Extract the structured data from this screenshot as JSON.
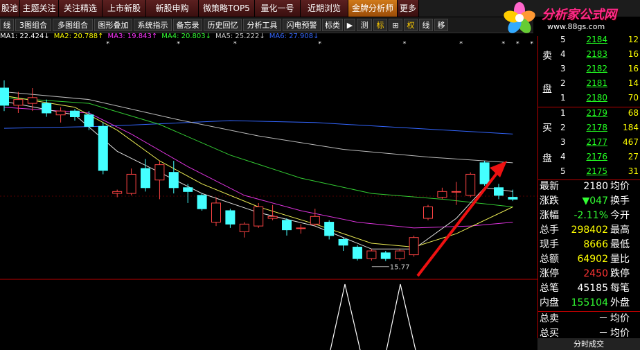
{
  "nav": {
    "tabs": [
      {
        "label": "股池"
      },
      {
        "label": "主题关注"
      },
      {
        "label": "关注精选"
      },
      {
        "label": "上市新股"
      },
      {
        "label": "新股申购"
      },
      {
        "label": "微策略TOP5"
      },
      {
        "label": "量化一号"
      },
      {
        "label": "近期浏览"
      },
      {
        "label": "金牌分析师"
      },
      {
        "label": "更多"
      }
    ],
    "active_index": 8
  },
  "toolbar": {
    "items": [
      {
        "label": "线"
      },
      {
        "label": "3图组合"
      },
      {
        "label": "多图组合"
      },
      {
        "label": "图形叠加"
      },
      {
        "label": "系统指示"
      },
      {
        "label": "备忘录"
      },
      {
        "label": "历史回忆"
      },
      {
        "label": "分析工具"
      },
      {
        "label": "闪电预警"
      },
      {
        "label": "标类"
      },
      {
        "label": "▶"
      },
      {
        "label": "测"
      },
      {
        "label": "标"
      },
      {
        "label": "⊞"
      },
      {
        "label": "权"
      },
      {
        "label": "线"
      },
      {
        "label": "移"
      }
    ]
  },
  "ma_legend": [
    {
      "label": "MA1: 22.424↓",
      "color": "#ffffff"
    },
    {
      "label": "MA2: 20.788↑",
      "color": "#ffff00"
    },
    {
      "label": "MA3: 19.843↑",
      "color": "#ff33ff"
    },
    {
      "label": "MA4: 20.803↓",
      "color": "#33ff33"
    },
    {
      "label": "MA5: 25.222↓",
      "color": "#cccccc"
    },
    {
      "label": "MA6: 27.908↓",
      "color": "#3366ff"
    }
  ],
  "chart_data": {
    "type": "candlestick",
    "low_marker": "15.77",
    "y_range": [
      15.0,
      26.5
    ],
    "candles": [
      {
        "o": 24.8,
        "c": 23.9,
        "h": 25.2,
        "l": 23.6
      },
      {
        "o": 23.9,
        "c": 24.2,
        "h": 24.6,
        "l": 23.5
      },
      {
        "o": 24.0,
        "c": 24.3,
        "h": 24.8,
        "l": 23.6
      },
      {
        "o": 24.0,
        "c": 23.5,
        "h": 24.2,
        "l": 23.3
      },
      {
        "o": 23.4,
        "c": 23.6,
        "h": 23.8,
        "l": 23.0
      },
      {
        "o": 23.6,
        "c": 23.3,
        "h": 23.7,
        "l": 23.1
      },
      {
        "o": 23.4,
        "c": 22.8,
        "h": 23.6,
        "l": 22.6
      },
      {
        "o": 22.8,
        "c": 20.5,
        "h": 23.0,
        "l": 20.3
      },
      {
        "o": 19.3,
        "c": 19.4,
        "h": 19.5,
        "l": 19.1
      },
      {
        "o": 19.3,
        "c": 20.3,
        "h": 20.6,
        "l": 19.2
      },
      {
        "o": 20.6,
        "c": 19.6,
        "h": 21.1,
        "l": 19.4
      },
      {
        "o": 20.0,
        "c": 20.8,
        "h": 21.0,
        "l": 19.0
      },
      {
        "o": 20.4,
        "c": 19.6,
        "h": 21.0,
        "l": 19.3
      },
      {
        "o": 19.6,
        "c": 19.4,
        "h": 19.8,
        "l": 18.8
      },
      {
        "o": 19.2,
        "c": 18.5,
        "h": 19.3,
        "l": 18.4
      },
      {
        "o": 17.8,
        "c": 18.8,
        "h": 19.1,
        "l": 17.6
      },
      {
        "o": 18.4,
        "c": 17.7,
        "h": 18.5,
        "l": 17.5
      },
      {
        "o": 17.3,
        "c": 17.7,
        "h": 17.8,
        "l": 17.0
      },
      {
        "o": 17.6,
        "c": 18.6,
        "h": 18.8,
        "l": 17.5
      },
      {
        "o": 18.0,
        "c": 18.1,
        "h": 18.7,
        "l": 17.9
      },
      {
        "o": 17.9,
        "c": 17.4,
        "h": 18.0,
        "l": 17.1
      },
      {
        "o": 17.5,
        "c": 17.5,
        "h": 17.7,
        "l": 17.2
      },
      {
        "o": 17.7,
        "c": 18.1,
        "h": 18.5,
        "l": 17.6
      },
      {
        "o": 17.8,
        "c": 17.1,
        "h": 17.9,
        "l": 16.9
      },
      {
        "o": 16.9,
        "c": 16.6,
        "h": 17.0,
        "l": 16.3
      },
      {
        "o": 16.5,
        "c": 15.9,
        "h": 16.6,
        "l": 15.8
      },
      {
        "o": 15.9,
        "c": 16.3,
        "h": 16.4,
        "l": 15.8
      },
      {
        "o": 16.2,
        "c": 15.9,
        "h": 16.3,
        "l": 15.77
      },
      {
        "o": 15.9,
        "c": 16.3,
        "h": 16.4,
        "l": 15.8
      },
      {
        "o": 16.1,
        "c": 17.0,
        "h": 17.1,
        "l": 16.0
      },
      {
        "o": 18.0,
        "c": 18.6,
        "h": 18.7,
        "l": 17.9
      },
      {
        "o": 19.1,
        "c": 19.4,
        "h": 19.6,
        "l": 19.0
      },
      {
        "o": 19.4,
        "c": 19.4,
        "h": 19.9,
        "l": 18.7
      },
      {
        "o": 19.2,
        "c": 20.3,
        "h": 20.4,
        "l": 19.1
      },
      {
        "o": 20.9,
        "c": 19.8,
        "h": 21.0,
        "l": 19.7
      },
      {
        "o": 19.6,
        "c": 19.2,
        "h": 19.8,
        "l": 19.0
      },
      {
        "o": 19.1,
        "c": 19.0,
        "h": 19.5,
        "l": 18.9
      }
    ],
    "ma_series": [
      {
        "color": "#3366ff",
        "values": [
          {
            "i": 0,
            "v": 22.7
          },
          {
            "i": 7,
            "v": 22.8
          },
          {
            "i": 16,
            "v": 23.1
          },
          {
            "i": 22,
            "v": 23.0
          },
          {
            "i": 29,
            "v": 22.7
          },
          {
            "i": 36,
            "v": 22.4
          }
        ]
      },
      {
        "color": "#bbbbbb",
        "values": [
          {
            "i": 0,
            "v": 24.6
          },
          {
            "i": 6,
            "v": 24.2
          },
          {
            "i": 12,
            "v": 23.2
          },
          {
            "i": 18,
            "v": 22.3
          },
          {
            "i": 24,
            "v": 21.6
          },
          {
            "i": 30,
            "v": 21.2
          },
          {
            "i": 36,
            "v": 20.9
          }
        ]
      },
      {
        "color": "#33cc33",
        "values": [
          {
            "i": 0,
            "v": 24.3
          },
          {
            "i": 6,
            "v": 24.0
          },
          {
            "i": 11,
            "v": 22.9
          },
          {
            "i": 16,
            "v": 21.3
          },
          {
            "i": 21,
            "v": 20.1
          },
          {
            "i": 26,
            "v": 19.3
          },
          {
            "i": 31,
            "v": 19.0
          },
          {
            "i": 36,
            "v": 18.6
          }
        ]
      },
      {
        "color": "#dd33dd",
        "values": [
          {
            "i": 0,
            "v": 23.8
          },
          {
            "i": 6,
            "v": 23.5
          },
          {
            "i": 9,
            "v": 22.4
          },
          {
            "i": 13,
            "v": 20.7
          },
          {
            "i": 17,
            "v": 19.2
          },
          {
            "i": 21,
            "v": 18.4
          },
          {
            "i": 25,
            "v": 17.8
          },
          {
            "i": 29,
            "v": 17.5
          },
          {
            "i": 33,
            "v": 17.6
          },
          {
            "i": 36,
            "v": 17.8
          }
        ]
      },
      {
        "color": "#eeee55",
        "values": [
          {
            "i": 0,
            "v": 24.4
          },
          {
            "i": 5,
            "v": 23.8
          },
          {
            "i": 8,
            "v": 22.6
          },
          {
            "i": 11,
            "v": 21.0
          },
          {
            "i": 14,
            "v": 19.8
          },
          {
            "i": 18,
            "v": 18.6
          },
          {
            "i": 22,
            "v": 17.7
          },
          {
            "i": 26,
            "v": 16.7
          },
          {
            "i": 29,
            "v": 16.5
          },
          {
            "i": 32,
            "v": 17.2
          },
          {
            "i": 36,
            "v": 18.6
          }
        ]
      },
      {
        "color": "#dddddd",
        "values": [
          {
            "i": 0,
            "v": 24.1
          },
          {
            "i": 5,
            "v": 23.4
          },
          {
            "i": 8,
            "v": 21.5
          },
          {
            "i": 11,
            "v": 20.4
          },
          {
            "i": 14,
            "v": 19.3
          },
          {
            "i": 18,
            "v": 18.3
          },
          {
            "i": 22,
            "v": 17.6
          },
          {
            "i": 26,
            "v": 16.4
          },
          {
            "i": 29,
            "v": 16.4
          },
          {
            "i": 32,
            "v": 18.0
          },
          {
            "i": 34,
            "v": 19.6
          },
          {
            "i": 36,
            "v": 19.4
          }
        ]
      }
    ],
    "star_marker_indices": [
      4,
      9,
      13,
      19,
      25,
      29,
      32,
      33,
      34,
      35
    ]
  },
  "order_book": {
    "sell_label": "卖盘",
    "buy_label": "买盘",
    "asks": [
      {
        "level": "5",
        "price": "2184",
        "vol": "12"
      },
      {
        "level": "4",
        "price": "2183",
        "vol": "16"
      },
      {
        "level": "3",
        "price": "2182",
        "vol": "16"
      },
      {
        "level": "2",
        "price": "2181",
        "vol": "14"
      },
      {
        "level": "1",
        "price": "2180",
        "vol": "70"
      }
    ],
    "bids": [
      {
        "level": "1",
        "price": "2179",
        "vol": "68"
      },
      {
        "level": "2",
        "price": "2178",
        "vol": "184"
      },
      {
        "level": "3",
        "price": "2177",
        "vol": "467"
      },
      {
        "level": "4",
        "price": "2176",
        "vol": "27"
      },
      {
        "level": "5",
        "price": "2175",
        "vol": "31"
      }
    ]
  },
  "stats": [
    {
      "label": "最新",
      "value": "2180",
      "color": "#ffffff",
      "label2": "均价"
    },
    {
      "label": "涨跌",
      "value": "▼047",
      "color": "#33ff33",
      "label2": "换手"
    },
    {
      "label": "涨幅",
      "value": "-2.11%",
      "color": "#33ff33",
      "label2": "今开"
    },
    {
      "label": "总手",
      "value": "298402",
      "color": "#ffff00",
      "label2": "最高"
    },
    {
      "label": "现手",
      "value": "8666",
      "color": "#ffff00",
      "label2": "最低"
    },
    {
      "label": "总额",
      "value": "64902",
      "color": "#ffff00",
      "label2": "量比"
    },
    {
      "label": "涨停",
      "value": "2450",
      "color": "#ff3333",
      "label2": "跌停"
    },
    {
      "label": "总笔",
      "value": "45185",
      "color": "#ffffff",
      "label2": "每笔"
    },
    {
      "label": "内盘",
      "value": "155104",
      "color": "#33ff33",
      "label2": "外盘"
    }
  ],
  "bottom_stats": [
    {
      "label": "总卖",
      "value": "－",
      "label2": "均价"
    },
    {
      "label": "总买",
      "value": "－",
      "label2": "均价"
    }
  ],
  "footer_tab": "分时成交",
  "logo": {
    "title": "分析家公式网",
    "url": "www.88gs.com"
  }
}
